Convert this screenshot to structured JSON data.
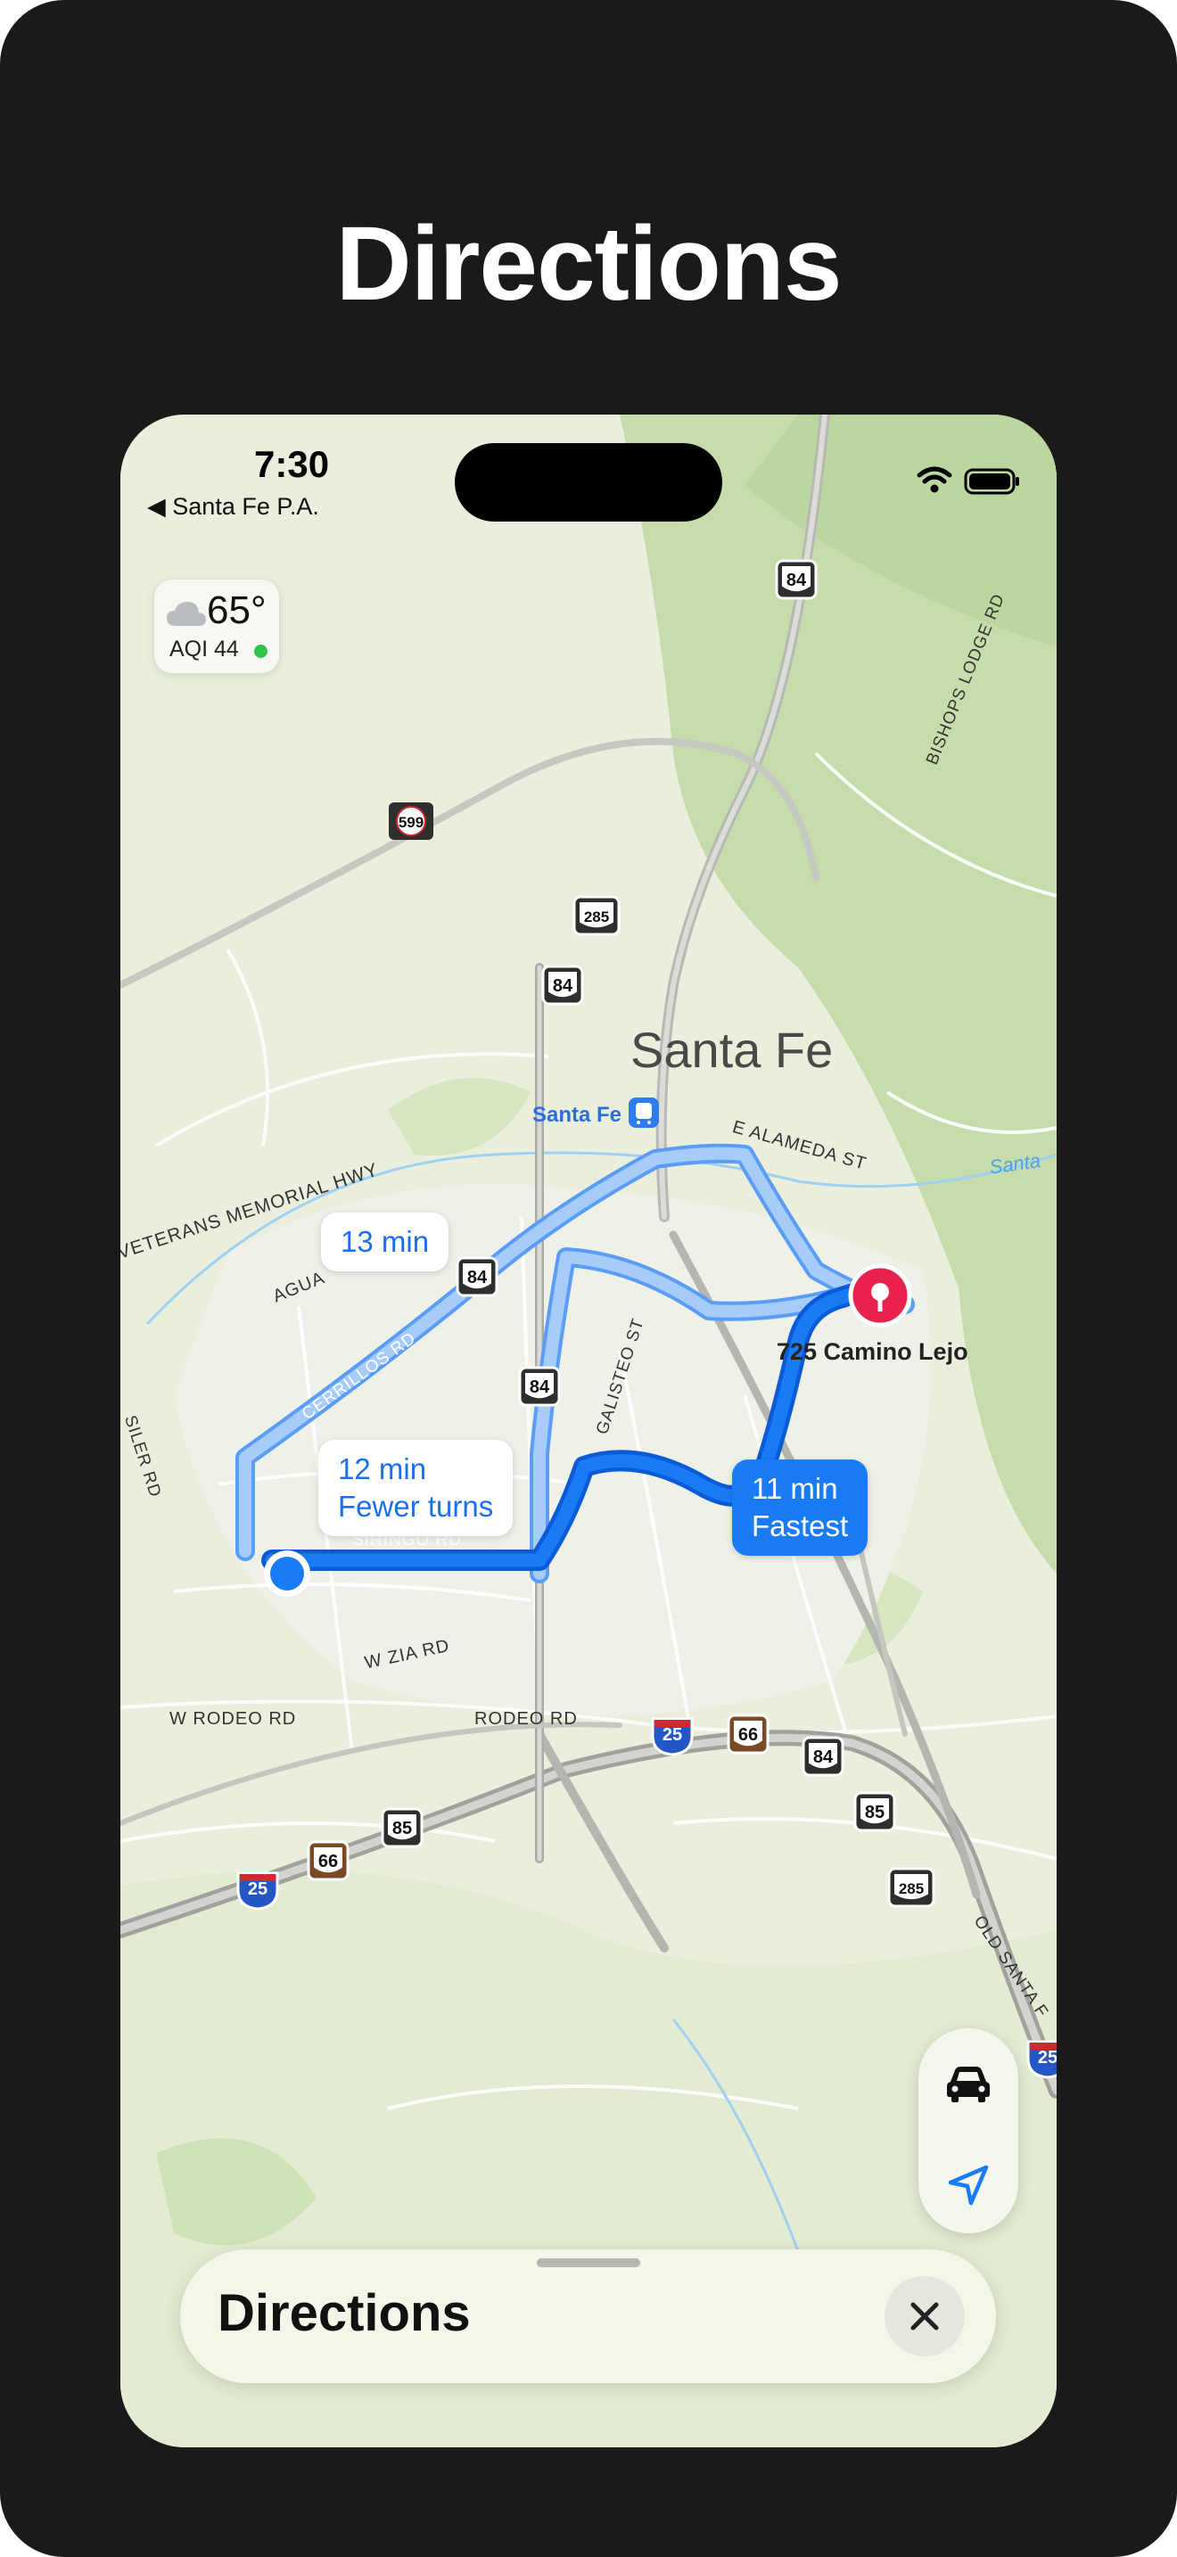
{
  "headline": "Directions",
  "status_bar": {
    "time": "7:30",
    "back_app": "Santa Fe P.A.",
    "icons": [
      "wifi-icon",
      "battery-icon"
    ]
  },
  "weather": {
    "icon": "cloud-icon",
    "temperature": "65°",
    "aqi": "AQI 44",
    "aqi_color": "#2ec24a"
  },
  "map": {
    "city": "Santa Fe",
    "transit_station": "Santa Fe",
    "destination": "725 Camino Lejo",
    "streets": {
      "veterans": "VETERANS MEMORIAL HWY",
      "bishops": "BISHOPS LODGE RD",
      "alameda": "E ALAMEDA ST",
      "santa_fe_river": "Santa",
      "agua": "AGUA",
      "cerrillos": "CERRILLOS RD",
      "siler": "SILER RD",
      "galisteo": "GALISTEO ST",
      "siringo": "SIRINGO RD",
      "zia": "W ZIA RD",
      "w_rodeo": "W RODEO RD",
      "rodeo": "RODEO RD",
      "old_santa": "OLD SANTA F"
    },
    "shields": {
      "s599": "599",
      "s84_top": "84",
      "s285_top": "285",
      "s84_mid": "84",
      "s84_route": "84",
      "s84_cerr": "84",
      "s25_mid": "25",
      "s66_mid": "66",
      "s84_low": "84",
      "s85_right": "85",
      "s285_low": "285",
      "s85_left": "85",
      "s66_left": "66",
      "s25_left": "25",
      "s25_edge": "25"
    },
    "routes": [
      {
        "time": "13 min",
        "note": ""
      },
      {
        "time": "12 min",
        "note": "Fewer turns"
      },
      {
        "time": "11 min",
        "note": "Fastest"
      }
    ],
    "colors": {
      "route_primary": "#1a7cf5",
      "route_alt": "#8fbdf9",
      "destination_pin": "#e8224c",
      "land": "#e9efdc",
      "park": "#c9deb0"
    }
  },
  "controls": {
    "mode_icon": "car-icon",
    "locate_icon": "location-arrow-icon"
  },
  "sheet": {
    "title": "Directions",
    "close_icon": "close-icon"
  }
}
